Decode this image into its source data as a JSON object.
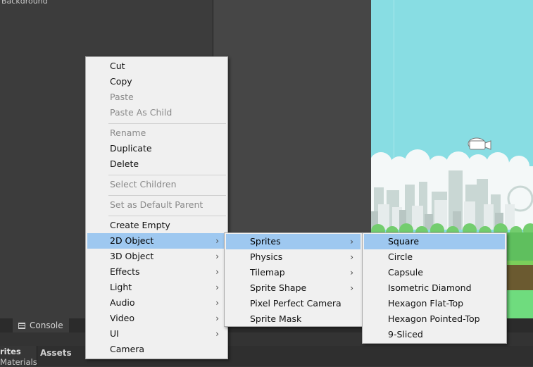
{
  "hierarchy": {
    "top_item": "Background"
  },
  "bottom": {
    "console_tab": "Console",
    "assets_crumb": "Assets",
    "project_items": [
      "rites",
      "Materials"
    ]
  },
  "menus": {
    "main": {
      "items": [
        {
          "label": "Cut",
          "disabled": false
        },
        {
          "label": "Copy",
          "disabled": false
        },
        {
          "label": "Paste",
          "disabled": true
        },
        {
          "label": "Paste As Child",
          "disabled": true
        },
        {
          "label": "Rename",
          "disabled": true
        },
        {
          "label": "Duplicate",
          "disabled": false
        },
        {
          "label": "Delete",
          "disabled": false
        },
        {
          "label": "Select Children",
          "disabled": true
        },
        {
          "label": "Set as Default Parent",
          "disabled": true
        },
        {
          "label": "Create Empty",
          "disabled": false
        },
        {
          "label": "2D Object",
          "disabled": false,
          "submenu": true,
          "highlighted": true
        },
        {
          "label": "3D Object",
          "disabled": false,
          "submenu": true
        },
        {
          "label": "Effects",
          "disabled": false,
          "submenu": true
        },
        {
          "label": "Light",
          "disabled": false,
          "submenu": true
        },
        {
          "label": "Audio",
          "disabled": false,
          "submenu": true
        },
        {
          "label": "Video",
          "disabled": false,
          "submenu": true
        },
        {
          "label": "UI",
          "disabled": false,
          "submenu": true
        },
        {
          "label": "Camera",
          "disabled": false
        }
      ]
    },
    "object_2d": {
      "items": [
        {
          "label": "Sprites",
          "submenu": true,
          "highlighted": true
        },
        {
          "label": "Physics",
          "submenu": true
        },
        {
          "label": "Tilemap",
          "submenu": true
        },
        {
          "label": "Sprite Shape",
          "submenu": true
        },
        {
          "label": "Pixel Perfect Camera"
        },
        {
          "label": "Sprite Mask"
        }
      ]
    },
    "sprites": {
      "items": [
        {
          "label": "Square",
          "highlighted": true
        },
        {
          "label": "Circle"
        },
        {
          "label": "Capsule"
        },
        {
          "label": "Isometric Diamond"
        },
        {
          "label": "Hexagon Flat-Top"
        },
        {
          "label": "Hexagon Pointed-Top"
        },
        {
          "label": "9-Sliced"
        }
      ]
    },
    "submenu_arrow": "›"
  },
  "colors": {
    "menu_bg": "#f0f0f0",
    "highlight": "#9ec8f0",
    "sky": "#88dde3",
    "grass": "#6fdc7e"
  }
}
